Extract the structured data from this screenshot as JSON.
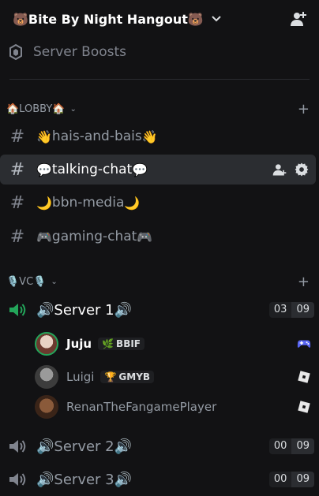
{
  "server": {
    "name": "🐻Bite By Night Hangout🐻"
  },
  "boosts": {
    "label": "Server Boosts"
  },
  "categories": [
    {
      "label": "🏠LOBBY🏠"
    },
    {
      "label": "🎙️VC🎙️"
    }
  ],
  "text_channels": [
    {
      "emoji_left": "👋",
      "name": "hais-and-bais",
      "emoji_right": "👋"
    },
    {
      "emoji_left": "💬",
      "name": "talking-chat",
      "emoji_right": "💬"
    },
    {
      "emoji_left": "🌙",
      "name": "bbn-media",
      "emoji_right": "🌙"
    },
    {
      "emoji_left": "🎮",
      "name": "gaming-chat",
      "emoji_right": "🎮"
    }
  ],
  "voice_channels": [
    {
      "name": "🔊Server 1🔊",
      "count": "03",
      "limit": "09"
    },
    {
      "name": "🔊Server 2🔊",
      "count": "00",
      "limit": "09"
    },
    {
      "name": "🔊Server 3🔊",
      "count": "00",
      "limit": "09"
    }
  ],
  "voice_users": [
    {
      "name": "Juju",
      "tag_icon": "🌿",
      "tag": "BBIF",
      "activity_icon": "gamepad-icon"
    },
    {
      "name": "Luigi",
      "tag_icon": "🏆",
      "tag": "GMYB",
      "activity_icon": "roblox-icon"
    },
    {
      "name": "RenanTheFangamePlayer",
      "activity_icon": "roblox-icon"
    }
  ],
  "colors": {
    "background": "#121214",
    "active_channel": "#2b2d31",
    "speaking_green": "#23a55a",
    "activity_blue": "#5865f2"
  }
}
